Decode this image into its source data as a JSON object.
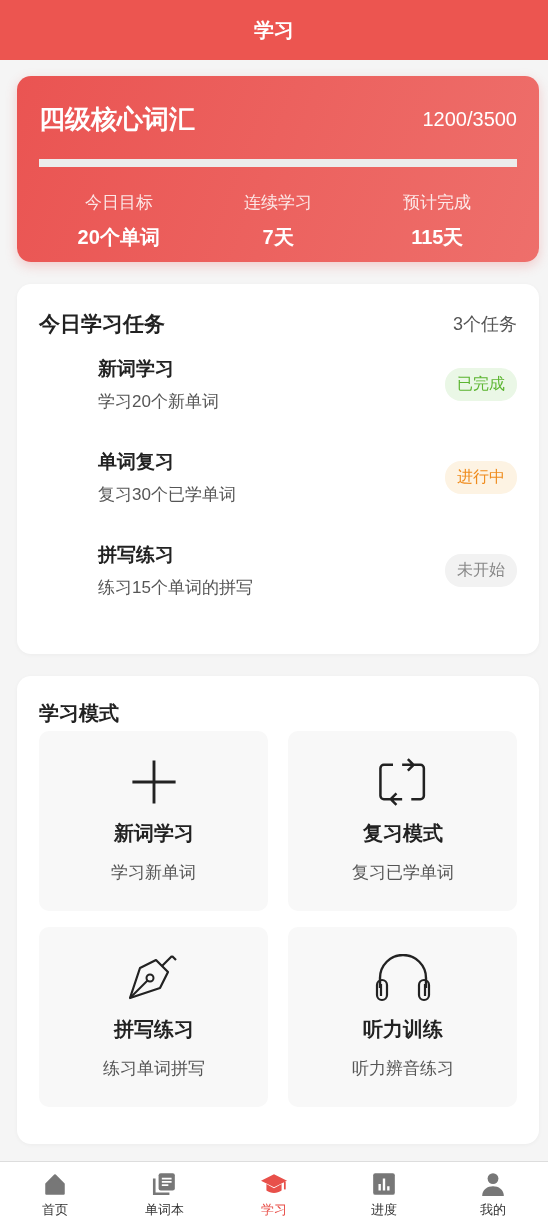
{
  "header": {
    "title": "学习"
  },
  "book": {
    "title": "四级核心词汇",
    "count": "1200/3500",
    "level": 1.0,
    "stats": [
      {
        "label": "今日目标",
        "value": "20个单词"
      },
      {
        "label": "连续学习",
        "value": "7天"
      },
      {
        "label": "预计完成",
        "value": "115天"
      }
    ]
  },
  "tasks": {
    "title": "今日学习任务",
    "count": "3个任务",
    "items": [
      {
        "name": "新词学习",
        "desc": "学习20个新单词",
        "status": "已完成",
        "kind": "done"
      },
      {
        "name": "单词复习",
        "desc": "复习30个已学单词",
        "status": "进行中",
        "kind": "active"
      },
      {
        "name": "拼写练习",
        "desc": "练习15个单词的拼写",
        "status": "未开始",
        "kind": "pending"
      }
    ]
  },
  "modes": {
    "title": "学习模式",
    "items": [
      {
        "name": "新词学习",
        "desc": "学习新单词"
      },
      {
        "name": "复习模式",
        "desc": "复习已学单词"
      },
      {
        "name": "拼写练习",
        "desc": "练习单词拼写"
      },
      {
        "name": "听力训练",
        "desc": "听力辨音练习"
      }
    ]
  },
  "nav": [
    {
      "label": "首页",
      "selected": false
    },
    {
      "label": "单词本",
      "selected": false
    },
    {
      "label": "学习",
      "selected": true
    },
    {
      "label": "进度",
      "selected": false
    },
    {
      "label": "我的",
      "selected": false
    }
  ]
}
